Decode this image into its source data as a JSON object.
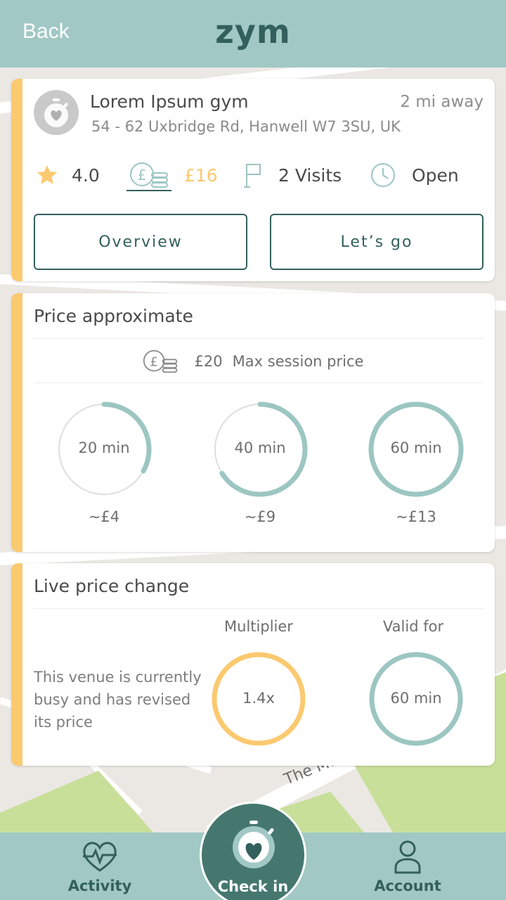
{
  "header": {
    "back_label": "Back",
    "logo": "zym"
  },
  "gym": {
    "name": "Lorem Ipsum gym",
    "distance": "2 mi away",
    "address": "54 - 62 Uxbridge Rd, Hanwell W7 3SU, UK",
    "rating": "4.0",
    "price": "£16",
    "visits": "2 Visits",
    "status": "Open",
    "overview_label": "Overview",
    "go_label": "Let’s go"
  },
  "price_approx": {
    "title": "Price approximate",
    "max_price": "£20",
    "max_label": "Max session price",
    "options": [
      {
        "duration": "20 min",
        "price": "~£4",
        "fill": 0.33
      },
      {
        "duration": "40 min",
        "price": "~£9",
        "fill": 0.66
      },
      {
        "duration": "60 min",
        "price": "~£13",
        "fill": 1.0
      }
    ]
  },
  "live_price": {
    "title": "Live price change",
    "description": "This venue is currently busy and has revised its price",
    "multiplier_label": "Multiplier",
    "multiplier_value": "1.4x",
    "valid_label": "Valid for",
    "valid_value": "60 min"
  },
  "map_labels": {
    "road": "The Mall Horse Guards"
  },
  "nav": {
    "activity": "Activity",
    "checkin": "Check in",
    "account": "Account"
  },
  "colors": {
    "header": "#a1c8c5",
    "primary": "#33605c",
    "accent": "#fbc96f",
    "ring": "#9cc6c2",
    "checkin_bg": "#45776f"
  },
  "icons": {
    "rating": "star-icon",
    "price": "pound-coins-icon",
    "visits": "flag-icon",
    "status": "clock-icon",
    "activity": "heart-pulse-icon",
    "checkin": "heart-stopwatch-icon",
    "account": "person-icon"
  }
}
